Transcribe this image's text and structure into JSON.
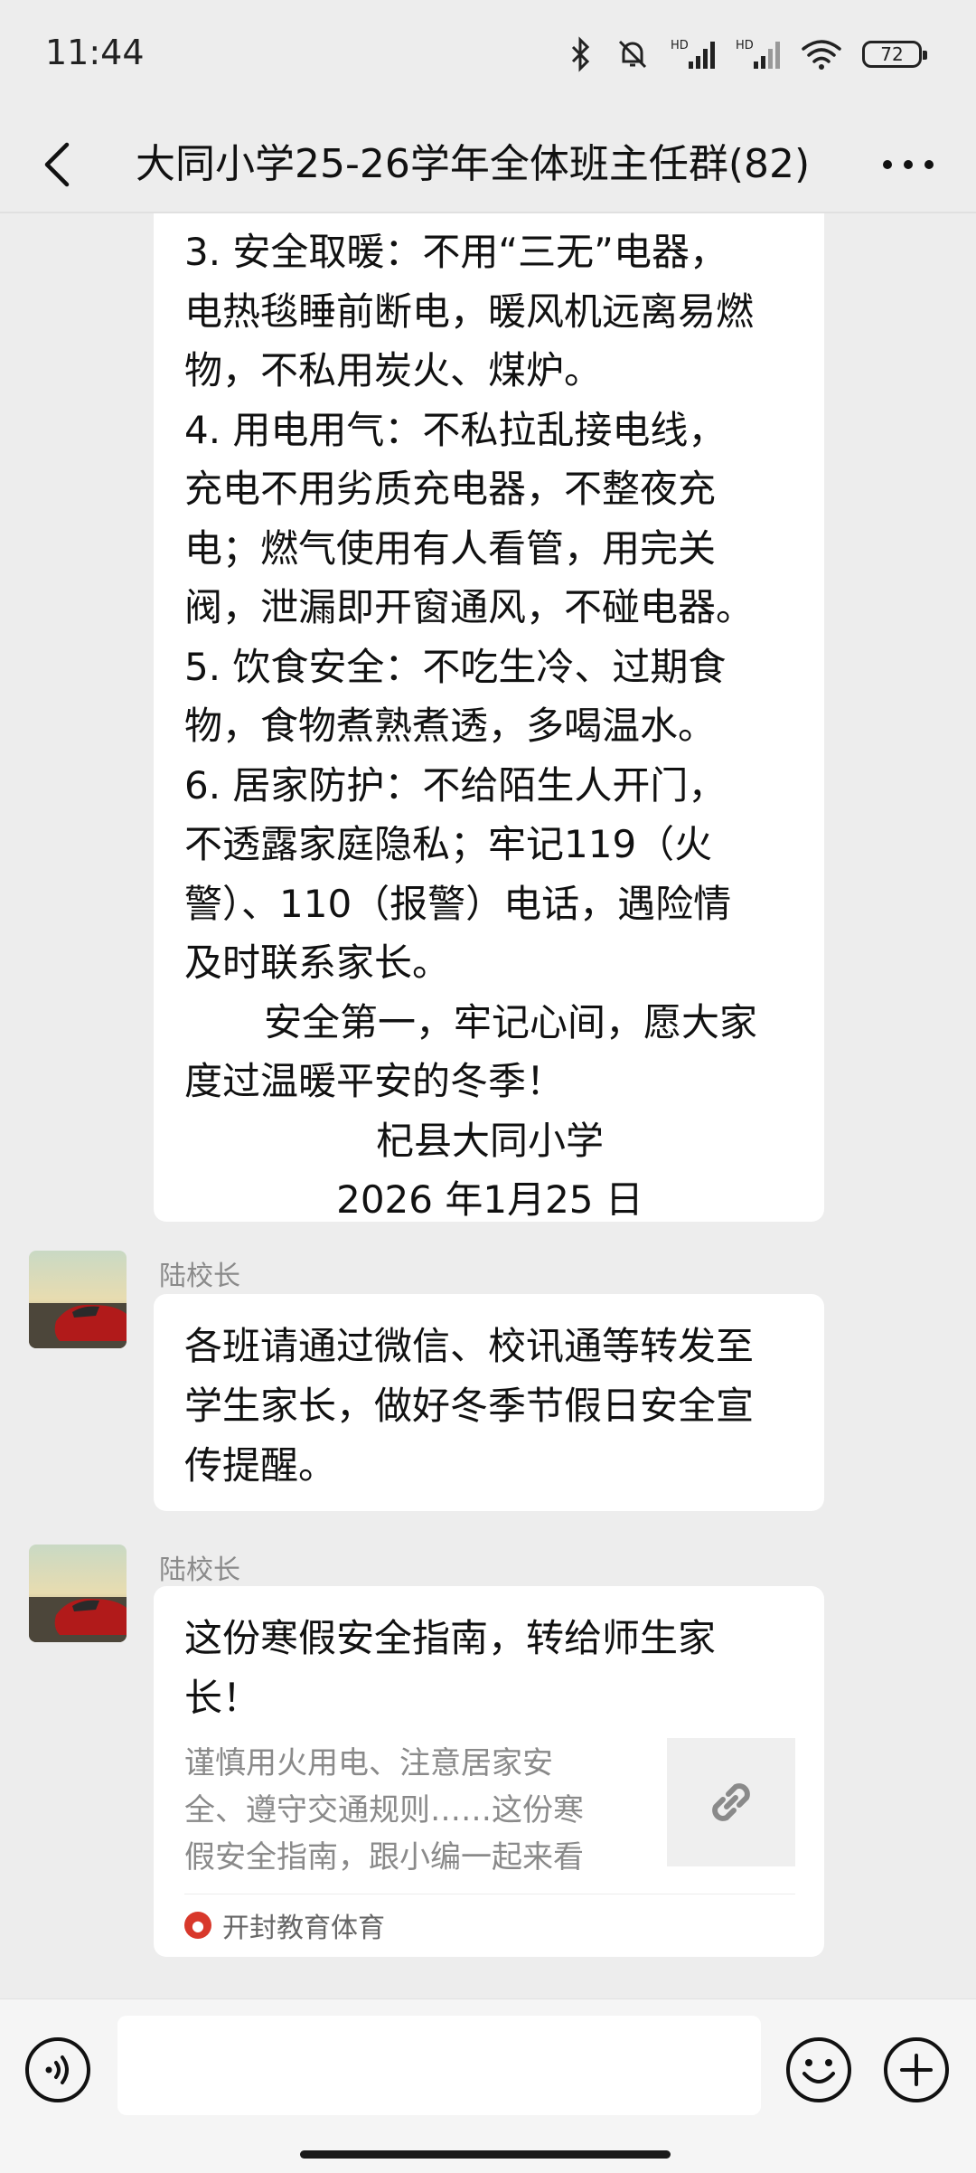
{
  "status_bar": {
    "time": "11:44",
    "battery": "72",
    "hd1": "HD",
    "hd2": "HD"
  },
  "header": {
    "title": "大同小学25-26学年全体班主任群(82)"
  },
  "messages": {
    "notice_lines": [
      "3. 安全取暖：不用“三无”电器，",
      "电热毯睡前断电，暖风机远离易燃",
      "物，不私用炭火、煤炉。",
      "4. 用电用气：不私拉乱接电线，",
      "充电不用劣质充电器，不整夜充",
      "电；燃气使用有人看管，用完关",
      "阀，泄漏即开窗通风，不碰电器。",
      "5. 饮食安全：不吃生冷、过期食",
      "物，食物煮熟煮透，多喝温水。",
      "6. 居家防护：不给陌生人开门，",
      "不透露家庭隐私；牢记119（火",
      "警）、110（报警）电话，遇险情",
      "及时联系家长。",
      "安全第一，牢记心间，愿大家",
      "度过温暖平安的冬季！",
      "杞县大同小学",
      "2026 年1月25 日"
    ],
    "msg2": {
      "sender": "陆校长",
      "lines": [
        "各班请通过微信、校讯通等转发至",
        "学生家长，做好冬季节假日安全宣",
        "传提醒。"
      ]
    },
    "msg3": {
      "sender": "陆校长",
      "title_lines": [
        "这份寒假安全指南，转给师生家",
        "长！"
      ],
      "desc_lines": [
        "谨慎用火用电、注意居家安",
        "全、遵守交通规则……这份寒",
        "假安全指南，跟小编一起来看"
      ],
      "source": "开封教育体育"
    }
  },
  "colors": {
    "background": "#ededed",
    "bubble": "#ffffff",
    "sender": "#8a8a8a"
  }
}
